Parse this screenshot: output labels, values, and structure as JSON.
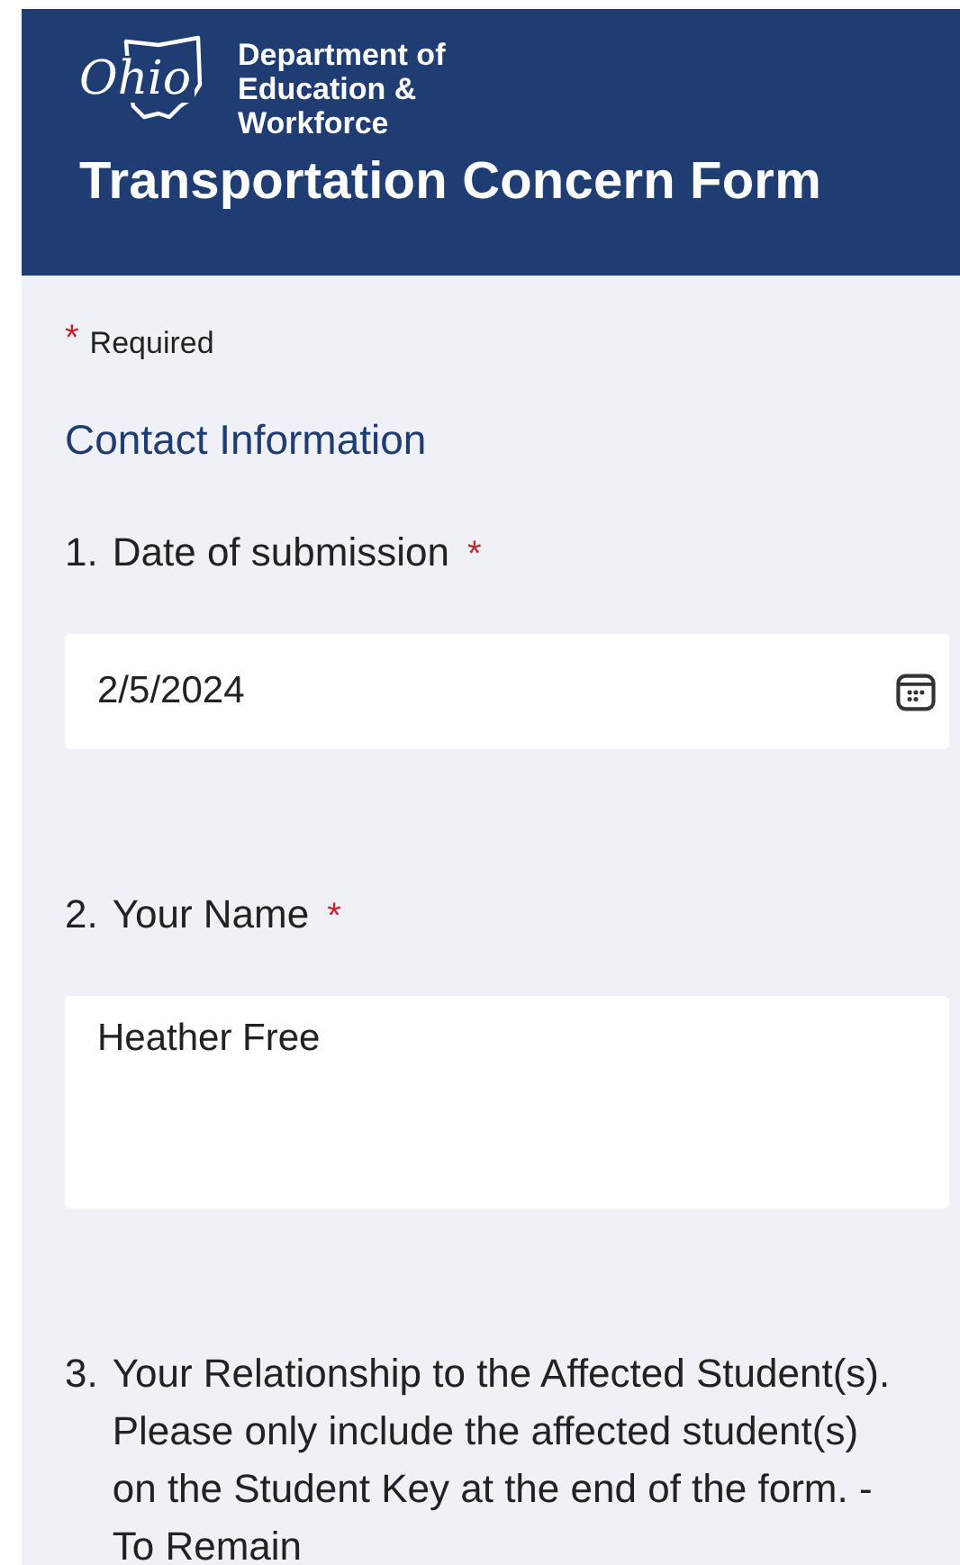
{
  "header": {
    "logo_text": "Ohio",
    "department": [
      "Department of",
      "Education &",
      "Workforce"
    ],
    "title": "Transportation Concern Form"
  },
  "required_note": {
    "mark": "*",
    "text": "Required"
  },
  "section_title": "Contact Information",
  "questions": [
    {
      "number": "1.",
      "label": "Date of submission",
      "required": true,
      "kind": "date",
      "value": "2/5/2024"
    },
    {
      "number": "2.",
      "label": "Your Name",
      "required": true,
      "kind": "text",
      "value": "Heather Free"
    },
    {
      "number": "3.",
      "label": "Your Relationship to the Affected Student(s). Please only include the affected student(s) on the Student Key at the end of the form. - To Remain",
      "required": false,
      "kind": "none"
    }
  ]
}
